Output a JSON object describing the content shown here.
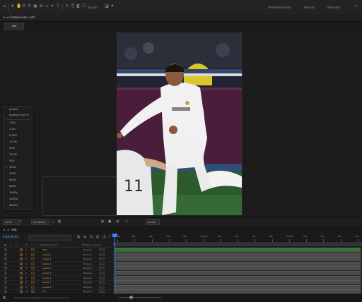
{
  "title_bar": {
    "toolbar_icons": [
      "home-icon",
      "select-tool-icon",
      "hand-tool-icon",
      "zoom-tool-icon",
      "rotate-tool-icon",
      "camera-tool-icon",
      "pan-tool-icon",
      "rectangle-tool-icon",
      "pen-tool-icon",
      "text-tool-icon",
      "brush-tool-icon",
      "clone-tool-icon",
      "eraser-tool-icon",
      "roto-tool-icon",
      "puppet-tool-icon"
    ],
    "snap_label": "Ajustar",
    "workspaces": [
      "Predeterminado",
      "Revisar",
      "Aprender"
    ]
  },
  "composition": {
    "tab_label": "Composición: edit",
    "flow_button": "edit"
  },
  "zoom_menu": {
    "fit_label": "Ajustar",
    "fit_up_label": "Ajustar a 100 %",
    "options": [
      "1,5%",
      "3,1%",
      "6,25%",
      "12,5%",
      "25%",
      "33,3%",
      "50%",
      "100%",
      "200%",
      "400%",
      "800%",
      "1600%",
      "3200%",
      "6400%"
    ],
    "selected": "100%"
  },
  "viewer_bar": {
    "zoom_value": "100%",
    "resolution_value": "Completa",
    "view_value": "Activa"
  },
  "timeline": {
    "tab_label": "edit",
    "timecode": "0;00;00;00",
    "ruler_labels": [
      "0;00f",
      "05f",
      "10f",
      "15f",
      "20f",
      "01;00f",
      "05f",
      "10f",
      "15f",
      "20f",
      "02;00f",
      "05f",
      "10f",
      "15f",
      "20f"
    ],
    "columns": {
      "source_name": "Nombre de capa",
      "parent": "Primario y vínculo"
    },
    "layers": [
      {
        "num": "1",
        "name": "flare",
        "mode": "Ninguno"
      },
      {
        "num": "2",
        "name": "Ajuste 1",
        "mode": "Ninguno"
      },
      {
        "num": "3",
        "name": "Ajuste 2",
        "mode": "Ninguno"
      },
      {
        "num": "4",
        "name": "Ajuste 3",
        "mode": "Ninguno"
      },
      {
        "num": "5",
        "name": "Ajuste 4",
        "mode": "Ninguno"
      },
      {
        "num": "6",
        "name": "Ajuste 5",
        "mode": "Ninguno"
      },
      {
        "num": "7",
        "name": "Ajuste 6",
        "mode": "Ninguno"
      },
      {
        "num": "8",
        "name": "Ajuste 7",
        "mode": "Ninguno"
      },
      {
        "num": "9",
        "name": "Ajuste 8",
        "mode": "Ninguno"
      },
      {
        "num": "10",
        "name": "clip",
        "mode": "Ninguno"
      }
    ]
  },
  "status_bar": {
    "render_text": "Tiempo de procesamiento de los fotogramas: 0 ms"
  },
  "colors": {
    "timecode": "#5da8ff",
    "playhead": "#3a86ff",
    "layer_name": "#c9a278",
    "top_track": "#3b6a3a"
  }
}
